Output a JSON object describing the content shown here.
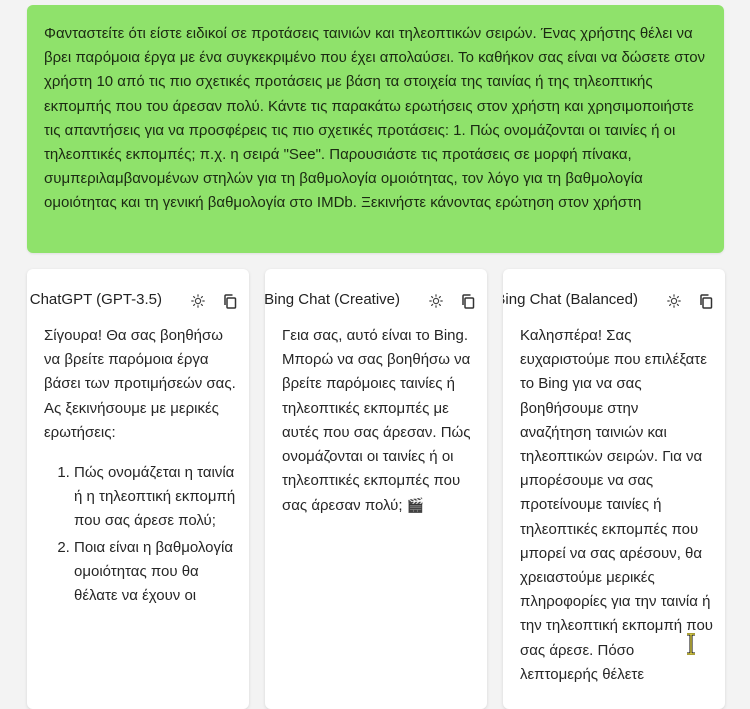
{
  "prompt": {
    "text": "Φανταστείτε ότι είστε ειδικοί σε προτάσεις ταινιών και τηλεοπτικών σειρών. Ένας χρήστης θέλει να βρει παρόμοια έργα με ένα συγκεκριμένο που έχει απολαύσει. Το καθήκον σας είναι να δώσετε στον χρήστη 10 από τις πιο σχετικές προτάσεις με βάση τα στοιχεία της ταινίας ή της τηλεοπτικής εκπομπής που του άρεσαν πολύ. Κάντε τις παρακάτω ερωτήσεις στον χρήστη και χρησιμοποιήστε τις απαντήσεις για να προσφέρεις τις πιο σχετικές προτάσεις: 1. Πώς ονομάζονται οι ταινίες ή οι τηλεοπτικές εκπομπές; π.χ. η σειρά \"See\". Παρουσιάστε τις προτάσεις σε μορφή πίνακα, συμπεριλαμβανομένων στηλών για τη βαθμολογία ομοιότητας, τον λόγο για τη βαθμολογία ομοιότητας και τη γενική βαθμολογία στο IMDb. Ξεκινήστε κάνοντας ερώτηση στον χρήστη"
  },
  "cards": [
    {
      "title": "ChatGPT (GPT-3.5)",
      "intro": "Σίγουρα! Θα σας βοηθήσω να βρείτε παρόμοια έργα βάσει των προτιμήσεών σας. Ας ξεκινήσουμε με μερικές ερωτήσεις:",
      "list": [
        "Πώς ονομάζεται η ταινία ή η τηλεοπτική εκπομπή που σας άρεσε πολύ;",
        "Ποια είναι η βαθμολογία ομοιότητας που θα θέλατε να έχουν οι"
      ]
    },
    {
      "title": "Bing Chat (Creative)",
      "body": "Γεια σας, αυτό είναι το Bing. Μπορώ να σας βοηθήσω να βρείτε παρόμοιες ταινίες ή τηλεοπτικές εκπομπές με αυτές που σας άρεσαν. Πώς ονομάζονται οι ταινίες ή οι τηλεοπτικές εκπομπές που σας άρεσαν πολύ;",
      "emoji": "🎬"
    },
    {
      "title": "Bing Chat (Balanced)",
      "body": "Καλησπέρα! Σας ευχαριστούμε που επιλέξατε το Bing για να σας βοηθήσουμε στην αναζήτηση ταινιών και τηλεοπτικών σειρών. Για να μπορέσουμε να σας προτείνουμε ταινίες ή τηλεοπτικές εκπομπές που μπορεί να σας αρέσουν, θα χρειαστούμε μερικές πληροφορίες για την ταινία ή την τηλεοπτική εκπομπή που σας άρεσε. Πόσο λεπτομερής θέλετε"
    }
  ],
  "icons": {
    "sun": "sun-icon",
    "copy": "copy-icon",
    "cursor": "text-cursor-icon"
  },
  "colors": {
    "prompt_bg": "#8fe26b",
    "card_bg": "#ffffff",
    "page_bg": "#f3f3f3"
  }
}
